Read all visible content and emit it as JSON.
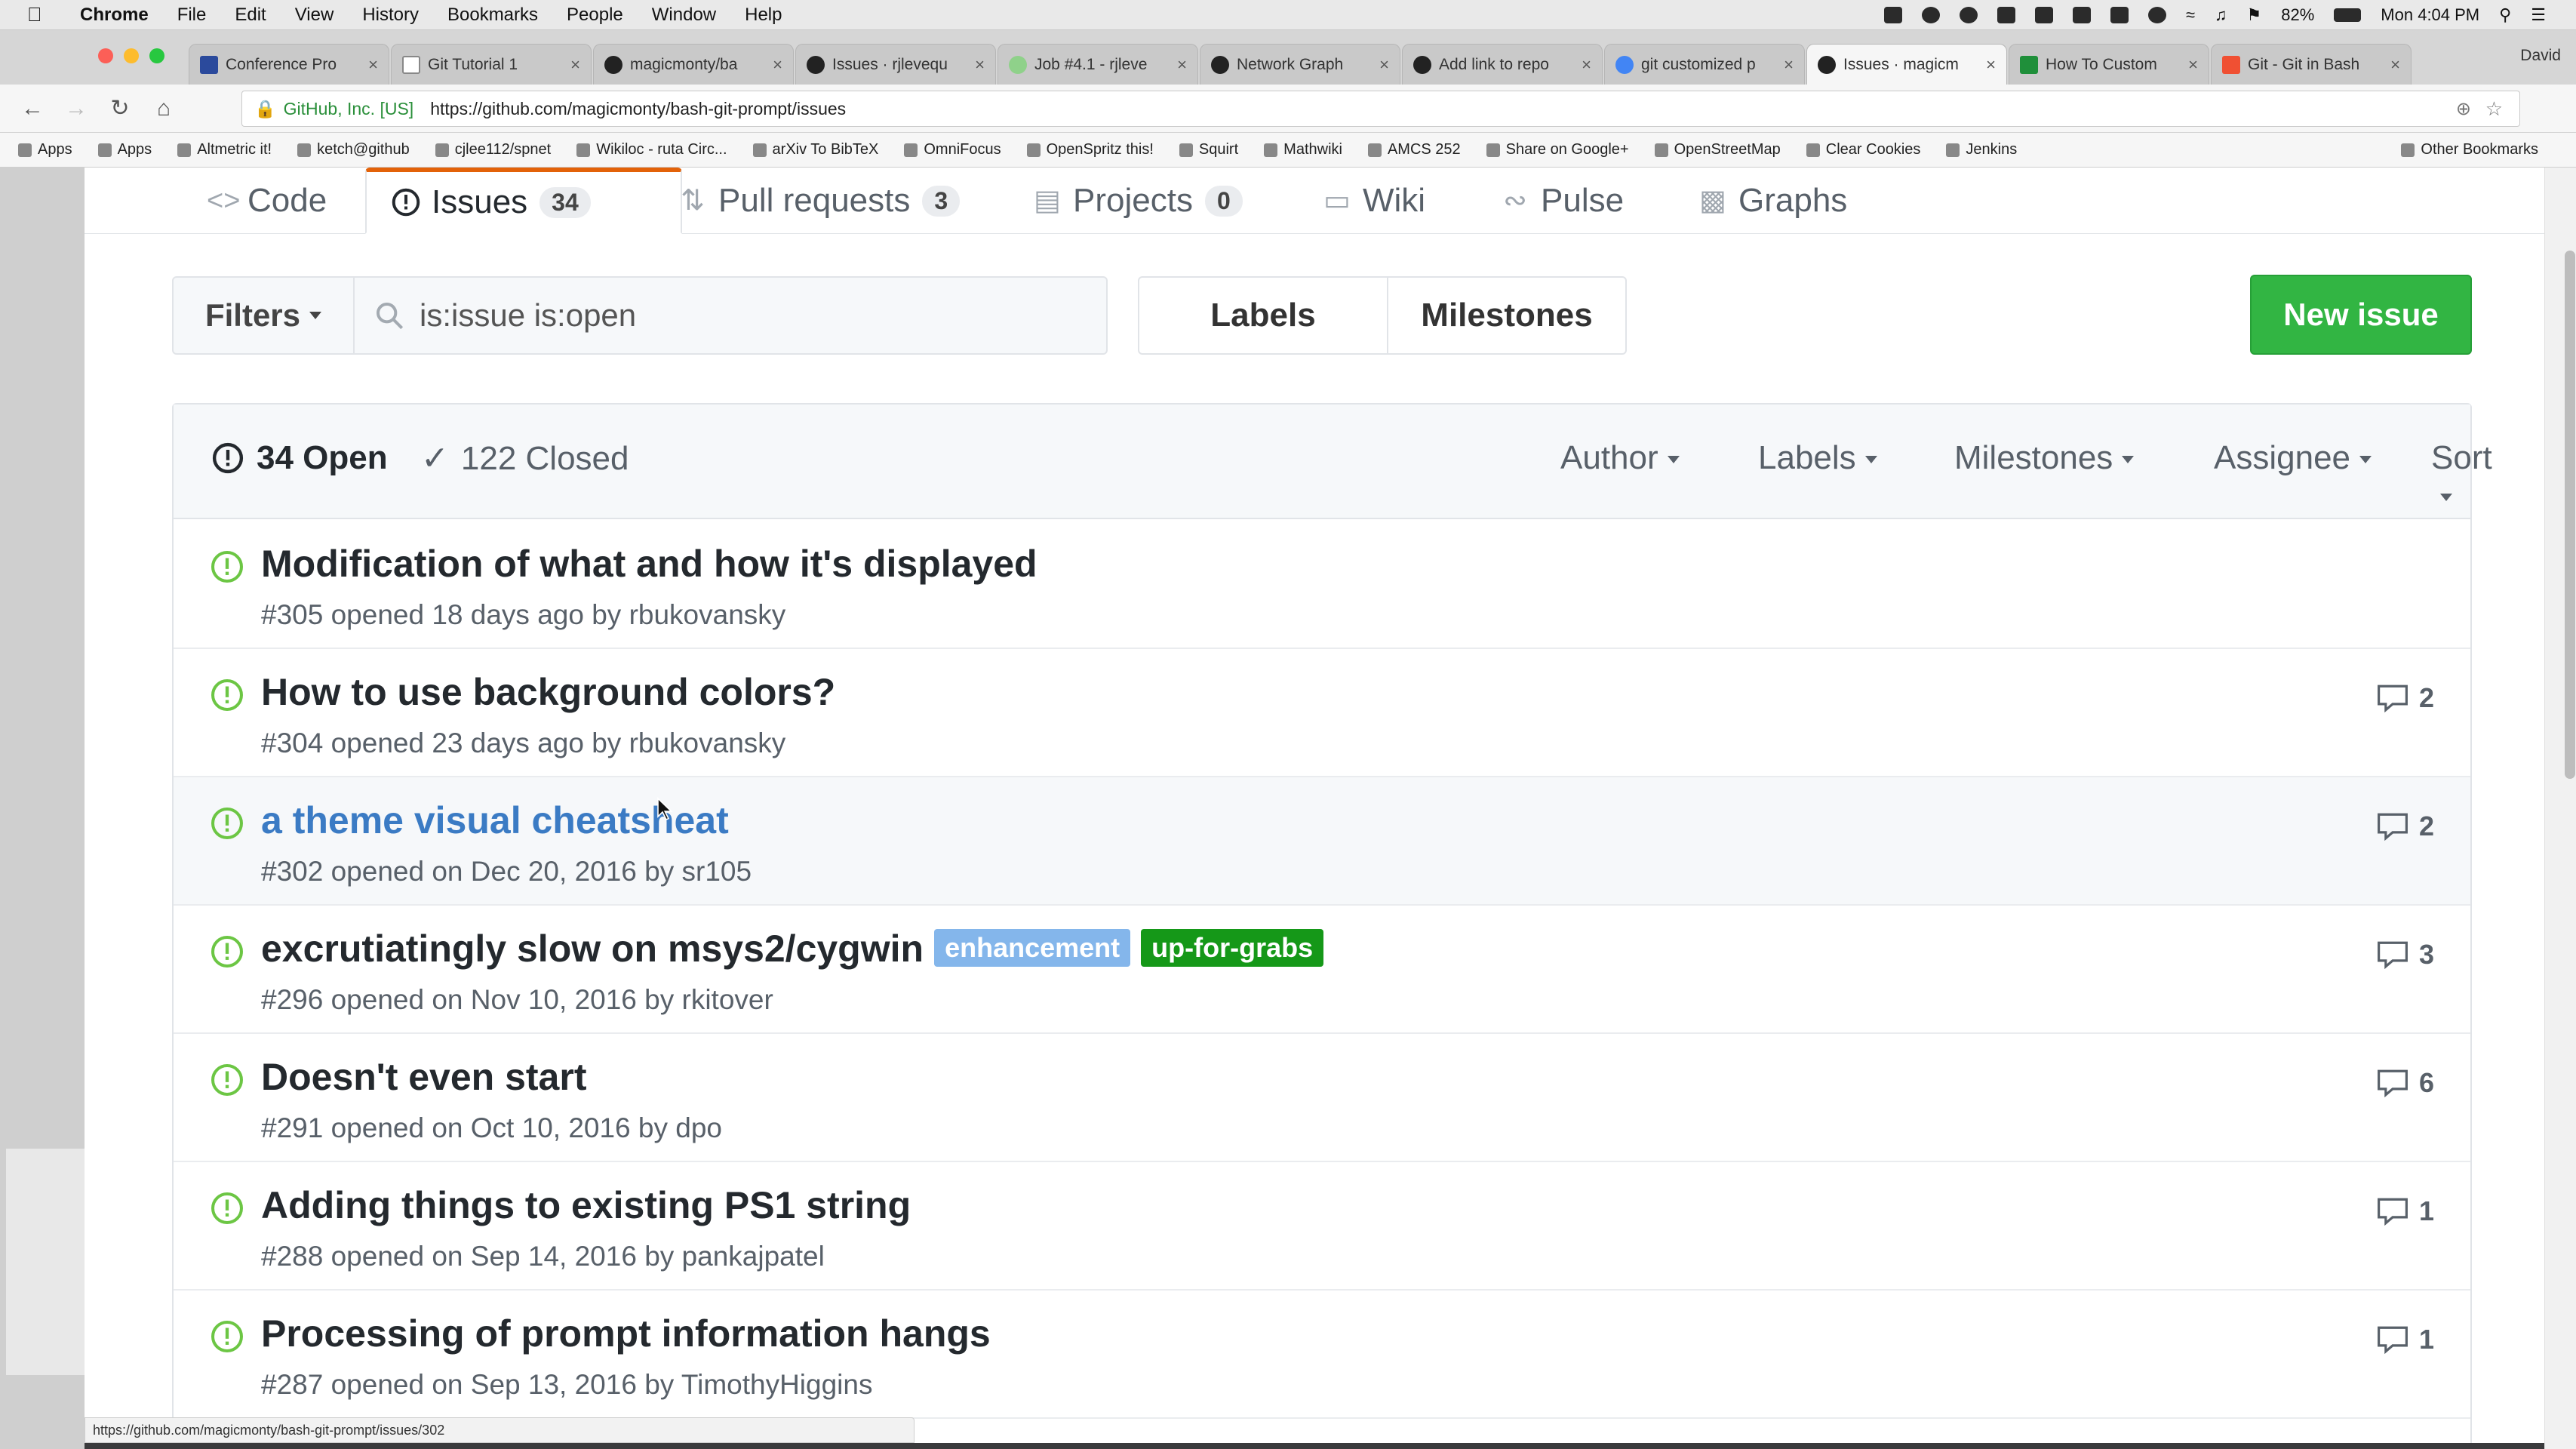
{
  "menubar": {
    "app": "Chrome",
    "items": [
      "File",
      "Edit",
      "View",
      "History",
      "Bookmarks",
      "People",
      "Window",
      "Help"
    ],
    "battery": "82%",
    "clock": "Mon 4:04 PM"
  },
  "browser": {
    "tabs": [
      {
        "title": "Conference Pro"
      },
      {
        "title": "Git Tutorial 1"
      },
      {
        "title": "magicmonty/ba"
      },
      {
        "title": "Issues · rjlevequ"
      },
      {
        "title": "Job #4.1 - rjleve"
      },
      {
        "title": "Network Graph"
      },
      {
        "title": "Add link to repo"
      },
      {
        "title": "git customized p"
      },
      {
        "title": "Issues · magicm"
      },
      {
        "title": "How To Custom"
      },
      {
        "title": "Git - Git in Bash"
      }
    ],
    "active_tab_index": 8,
    "profile": "David",
    "url_org": "GitHub, Inc. [US]",
    "url": "https://github.com/magicmonty/bash-git-prompt/issues",
    "bookmarks": [
      "Apps",
      "Apps",
      "Altmetric it!",
      "ketch@github",
      "cjlee112/spnet",
      "Wikiloc - ruta Circ...",
      "arXiv To BibTeX",
      "OmniFocus",
      "OpenSpritz this!",
      "Squirt",
      "Mathwiki",
      "AMCS 252",
      "Share on Google+",
      "OpenStreetMap",
      "Clear Cookies",
      "Jenkins"
    ],
    "other_bookmarks": "Other Bookmarks",
    "status_url": "https://github.com/magicmonty/bash-git-prompt/issues/302"
  },
  "repo_nav": {
    "code": "Code",
    "issues": "Issues",
    "issues_count": "34",
    "pulls": "Pull requests",
    "pulls_count": "3",
    "projects": "Projects",
    "projects_count": "0",
    "wiki": "Wiki",
    "pulse": "Pulse",
    "graphs": "Graphs"
  },
  "subnav": {
    "filters": "Filters",
    "search_value": "is:issue is:open",
    "labels": "Labels",
    "milestones": "Milestones",
    "new_issue": "New issue"
  },
  "issues_header": {
    "open": "34 Open",
    "closed": "122 Closed",
    "author": "Author",
    "labels": "Labels",
    "milestones": "Milestones",
    "assignee": "Assignee",
    "sort": "Sort"
  },
  "colors": {
    "open_icon": "#6cc644",
    "label_enhancement": "#84b6eb",
    "label_up_for_grabs": "#159818",
    "new_issue_bg": "#32b543"
  },
  "issues": [
    {
      "title": "Modification of what and how it's displayed",
      "meta": "#305 opened 18 days ago by rbukovansky",
      "comments": "",
      "labels": []
    },
    {
      "title": "How to use background colors?",
      "meta": "#304 opened 23 days ago by rbukovansky",
      "comments": "2",
      "labels": []
    },
    {
      "title": "a theme visual cheatsheat",
      "meta": "#302 opened on Dec 20, 2016 by sr105",
      "comments": "2",
      "labels": []
    },
    {
      "title": "excrutiatingly slow on msys2/cygwin",
      "meta": "#296 opened on Nov 10, 2016 by rkitover",
      "comments": "3",
      "labels": [
        "enhancement",
        "up-for-grabs"
      ]
    },
    {
      "title": "Doesn't even start",
      "meta": "#291 opened on Oct 10, 2016 by dpo",
      "comments": "6",
      "labels": []
    },
    {
      "title": "Adding things to existing PS1 string",
      "meta": "#288 opened on Sep 14, 2016 by pankajpatel",
      "comments": "1",
      "labels": []
    },
    {
      "title": "Processing of prompt information hangs",
      "meta": "#287 opened on Sep 13, 2016 by TimothyHiggins",
      "comments": "1",
      "labels": []
    }
  ]
}
